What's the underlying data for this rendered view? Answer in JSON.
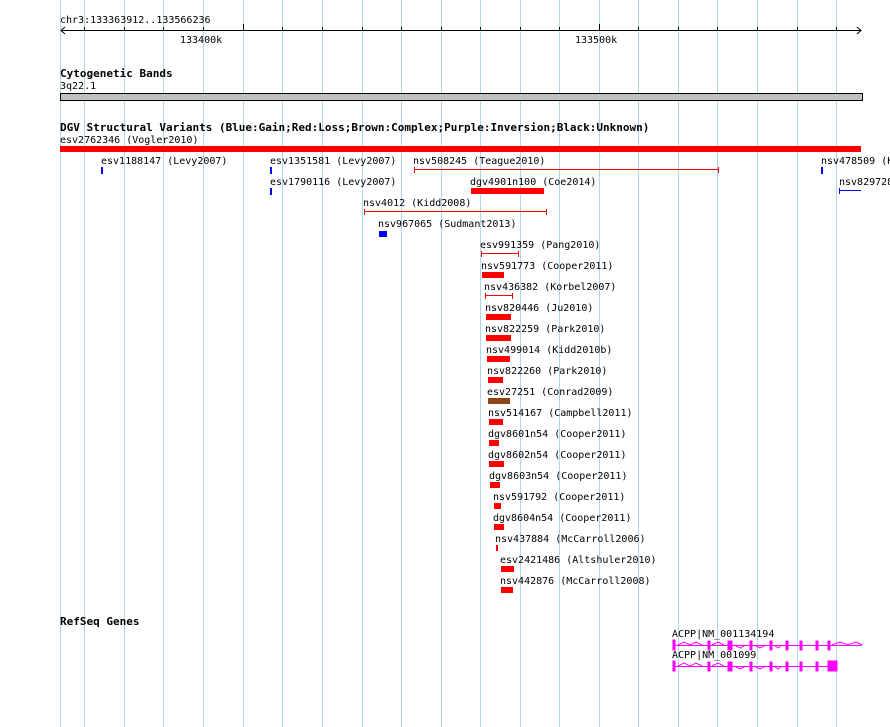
{
  "ruler": {
    "coords": "chr3:133363912..133566236",
    "ticks": [
      "133400k",
      "133500k"
    ]
  },
  "cytoband": {
    "title": "Cytogenetic Bands",
    "band": "3q22.1"
  },
  "dgv": {
    "title": "DGV Structural Variants (Blue:Gain;Red:Loss;Brown:Complex;Purple:Inversion;Black:Unknown)",
    "variants": [
      {
        "label": "esv2762346 (Vogler2010)",
        "type": "loss"
      },
      {
        "label": "esv1188147 (Levy2007)",
        "type": "gain"
      },
      {
        "label": "esv1351581 (Levy2007)",
        "type": "gain"
      },
      {
        "label": "nsv508245 (Teague2010)",
        "type": "loss"
      },
      {
        "label": "nsv478509 (K",
        "type": "gain"
      },
      {
        "label": "esv1790116 (Levy2007)",
        "type": "gain"
      },
      {
        "label": "dgv4901n100 (Coe2014)",
        "type": "loss"
      },
      {
        "label": "nsv829728",
        "type": "gain"
      },
      {
        "label": "nsv4012 (Kidd2008)",
        "type": "loss"
      },
      {
        "label": "nsv967065 (Sudmant2013)",
        "type": "gain"
      },
      {
        "label": "esv991359 (Pang2010)",
        "type": "loss"
      },
      {
        "label": "nsv591773 (Cooper2011)",
        "type": "loss"
      },
      {
        "label": "nsv436382 (Korbel2007)",
        "type": "loss"
      },
      {
        "label": "nsv820446 (Ju2010)",
        "type": "loss"
      },
      {
        "label": "nsv822259 (Park2010)",
        "type": "loss"
      },
      {
        "label": "nsv499014 (Kidd2010b)",
        "type": "loss"
      },
      {
        "label": "nsv822260 (Park2010)",
        "type": "loss"
      },
      {
        "label": "esv27251 (Conrad2009)",
        "type": "complex"
      },
      {
        "label": "nsv514167 (Campbell2011)",
        "type": "loss"
      },
      {
        "label": "dgv8601n54 (Cooper2011)",
        "type": "loss"
      },
      {
        "label": "dgv8602n54 (Cooper2011)",
        "type": "loss"
      },
      {
        "label": "dgv8603n54 (Cooper2011)",
        "type": "loss"
      },
      {
        "label": "nsv591792 (Cooper2011)",
        "type": "loss"
      },
      {
        "label": "dgv8604n54 (Cooper2011)",
        "type": "loss"
      },
      {
        "label": "nsv437884 (McCarroll2006)",
        "type": "loss"
      },
      {
        "label": "esv2421486 (Altshuler2010)",
        "type": "loss"
      },
      {
        "label": "nsv442876 (McCarroll2008)",
        "type": "loss"
      }
    ]
  },
  "refseq": {
    "title": "RefSeq Genes",
    "genes": [
      {
        "label": "ACPP|NM_001134194"
      },
      {
        "label": "ACPP|NM_001099"
      }
    ]
  },
  "colors": {
    "gain": "#0000ff",
    "loss": "#ff0000",
    "complex": "#8b4513",
    "inversion": "#800080",
    "unknown": "#000000",
    "gene": "#ff00ff",
    "grid": "#add8e6"
  }
}
